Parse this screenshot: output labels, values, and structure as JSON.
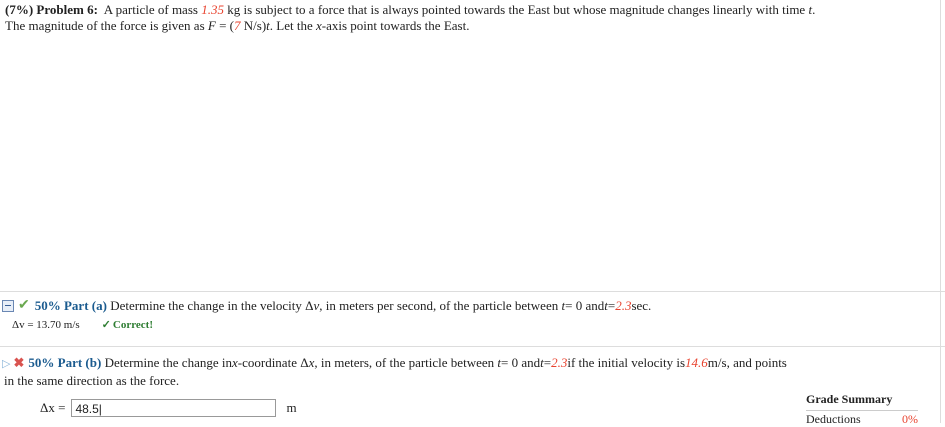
{
  "problem": {
    "weight": "(7%)",
    "label": "Problem 6:",
    "text1": "A particle of mass",
    "mass": "1.35",
    "text2": "kg is subject to a force that is always pointed towards the East but whose magnitude changes linearly with time",
    "t": "t",
    "dot": ".",
    "text3": "The magnitude of the force is given as",
    "F": "F",
    "eq_open": " = (",
    "k": "7",
    "eq_close": " N/s)",
    "text4": ". Let the",
    "x": "x",
    "text5": "-axis point towards the East."
  },
  "part_a": {
    "score": "50%",
    "label": "Part (a)",
    "text1": "Determine the change in the velocity Δ",
    "v": "v",
    "text2": ", in meters per second, of the particle between",
    "t1": "t",
    "eq1": " = 0 and ",
    "t2": "t",
    "eq2": " = ",
    "time": "2.3",
    "unit": " sec.",
    "answer_label": "Δv = 13.70 m/s",
    "correct": "Correct!"
  },
  "part_b": {
    "score": "50%",
    "label": "Part (b)",
    "text1": "Determine the change in ",
    "x": "x",
    "text2": "-coordinate Δ",
    "x2": "x",
    "text3": ", in meters, of the particle between",
    "t1": "t",
    "eq1": " = 0 and ",
    "t2": "t",
    "eq2": " = ",
    "time": "2.3",
    "text4": " if the initial velocity is ",
    "v0": "14.6",
    "text5": " m/s, and points",
    "text6": "in the same direction as the force.",
    "input_label": "Δx =",
    "input_value": "48.5|",
    "unit": "m"
  },
  "grade_summary": {
    "title": "Grade Summary",
    "deductions_label": "Deductions",
    "deductions_value": "0%"
  }
}
